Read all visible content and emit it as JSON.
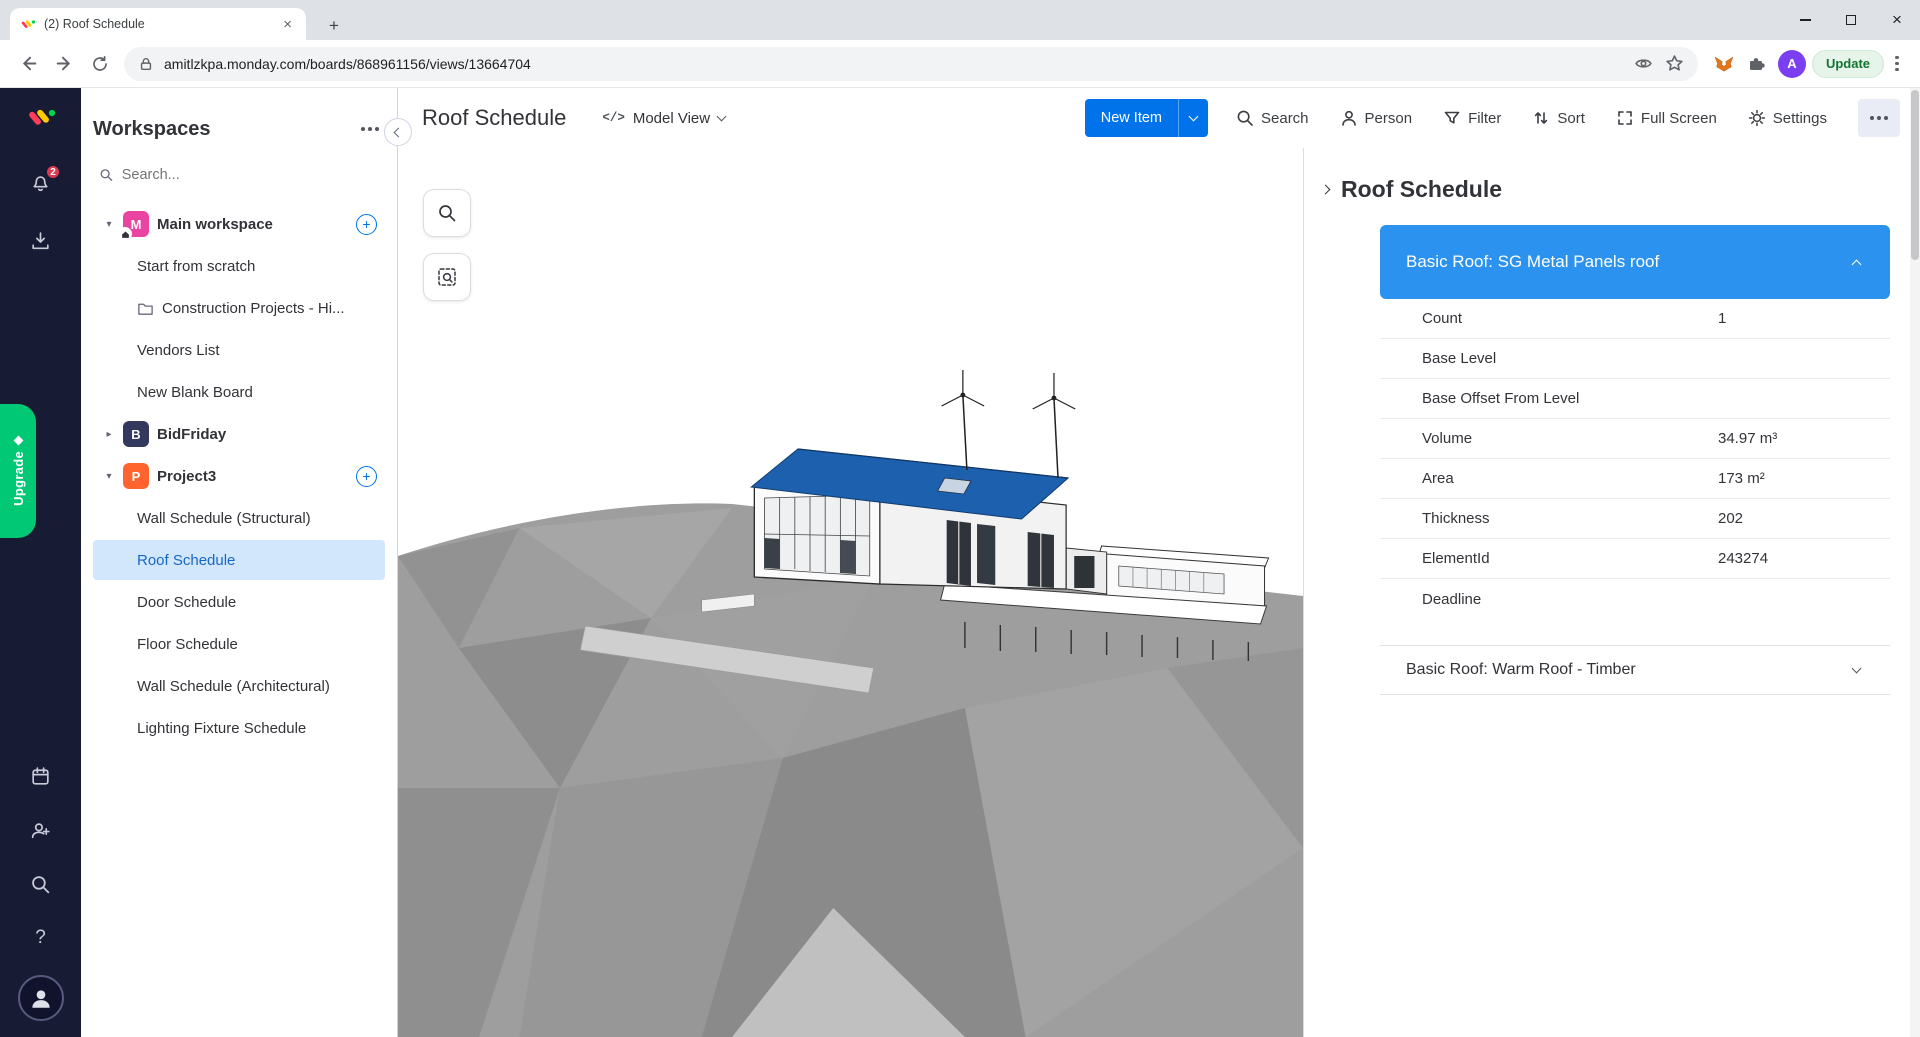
{
  "browser": {
    "tab_title": "(2) Roof Schedule",
    "url": "amitlzkpa.monday.com/boards/868961156/views/13664704",
    "update_label": "Update",
    "profile_letter": "A"
  },
  "rail": {
    "notification_count": "2",
    "upgrade_label": "Upgrade",
    "help_label": "?"
  },
  "workspaces": {
    "title": "Workspaces",
    "search_placeholder": "Search...",
    "main_workspace": {
      "avatar": "M",
      "label": "Main workspace"
    },
    "links": {
      "start": "Start from scratch",
      "construction": "Construction Projects - Hi...",
      "vendors": "Vendors List",
      "new_blank": "New Blank Board"
    },
    "bidfriday": {
      "avatar": "B",
      "label": "BidFriday"
    },
    "project3": {
      "avatar": "P",
      "label": "Project3"
    },
    "boards": [
      "Wall Schedule (Structural)",
      "Roof Schedule",
      "Door Schedule",
      "Floor Schedule",
      "Wall Schedule (Architectural)",
      "Lighting Fixture Schedule"
    ]
  },
  "header": {
    "title": "Roof Schedule",
    "view_icon": "</>",
    "view_label": "Model View",
    "new_item_label": "New Item",
    "actions": [
      "Search",
      "Person",
      "Filter",
      "Sort",
      "Full Screen",
      "Settings"
    ]
  },
  "details": {
    "title": "Roof Schedule",
    "section1": {
      "title": "Basic Roof: SG Metal Panels roof",
      "rows": [
        {
          "label": "Count",
          "value": "1"
        },
        {
          "label": "Base Level",
          "value": ""
        },
        {
          "label": "Base Offset From Level",
          "value": ""
        },
        {
          "label": "Volume",
          "value": "34.97 m³"
        },
        {
          "label": "Area",
          "value": "173 m²"
        },
        {
          "label": "Thickness",
          "value": "202"
        },
        {
          "label": "ElementId",
          "value": "243274"
        },
        {
          "label": "Deadline",
          "value": ""
        }
      ]
    },
    "section2": {
      "title": "Basic Roof: Warm Roof - Timber"
    }
  },
  "colors": {
    "monday_blue": "#0073ea",
    "card_blue": "#2b92ef",
    "upgrade_green": "#00c875",
    "rail_bg": "#181b34",
    "selected_item_bg": "#d3e7fc",
    "roof_blue": "#1c60ae"
  }
}
